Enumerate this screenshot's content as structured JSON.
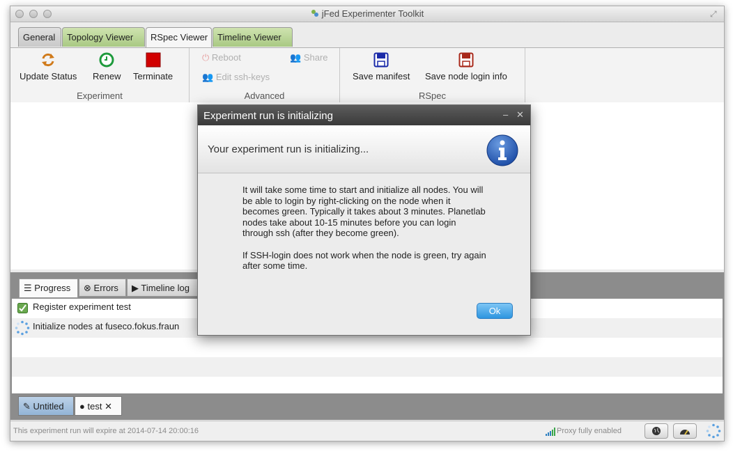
{
  "window": {
    "title": "jFed Experimenter Toolkit"
  },
  "main_tabs": [
    {
      "label": "General"
    },
    {
      "label": "Topology Viewer"
    },
    {
      "label": "RSpec Viewer"
    },
    {
      "label": "Timeline Viewer"
    }
  ],
  "ribbon": {
    "experiment": {
      "update_status": "Update Status",
      "renew": "Renew",
      "terminate": "Terminate",
      "group_title": "Experiment"
    },
    "advanced": {
      "reboot": "Reboot",
      "share": "Share",
      "edit_ssh_keys": "Edit ssh-keys",
      "group_title": "Advanced"
    },
    "rspec": {
      "save_manifest": "Save manifest",
      "save_node_login_info": "Save node login info",
      "group_title": "RSpec"
    }
  },
  "lower_tabs": [
    {
      "label": "Progress"
    },
    {
      "label": "Errors"
    },
    {
      "label": "Timeline log"
    }
  ],
  "progress_items": [
    {
      "text": "Register experiment test",
      "status": "done"
    },
    {
      "text": "Initialize nodes at fuseco.fokus.fraun",
      "status": "running"
    }
  ],
  "bottom_tabs": [
    {
      "label": "Untitled"
    },
    {
      "label": "test"
    }
  ],
  "status_bar": {
    "expiry_text": "This experiment run will expire at 2014-07-14 20:00:16",
    "proxy_text": "Proxy fully enabled"
  },
  "dialog": {
    "title": "Experiment run is initializing",
    "header": "Your experiment run is initializing...",
    "paragraph1": "It will take some time to start and initialize all nodes. You will be able to login by right-clicking on the node when it becomes green. Typically it takes about 3 minutes. Planetlab nodes take about 10-15 minutes before you can login through ssh (after they become green).",
    "paragraph2": "If SSH-login does not work when the node is green, try again after some time.",
    "ok_label": "Ok"
  },
  "colors": {
    "ok_button": "#2d95e0",
    "terminate": "#d10000",
    "renew": "#1e9a3c",
    "update_status": "#d07a1a",
    "save_manifest": "#1a2aa8",
    "save_node_login": "#a8281a",
    "info_icon": "#1f4fa8"
  }
}
